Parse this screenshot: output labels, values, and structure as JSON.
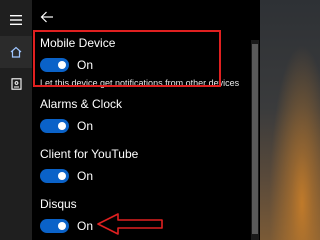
{
  "sidebar": {
    "menu_icon": "hamburger-icon",
    "home_icon": "home-icon",
    "notebook_icon": "notebook-icon"
  },
  "header": {
    "back_icon": "back-arrow-icon"
  },
  "settings": [
    {
      "name": "Mobile Device",
      "state": "On",
      "description": "Let this device get notifications from other devices"
    },
    {
      "name": "Alarms & Clock",
      "state": "On"
    },
    {
      "name": "Client for YouTube",
      "state": "On"
    },
    {
      "name": "Disqus",
      "state": "On"
    }
  ],
  "colors": {
    "accent": "#0a62c8",
    "annotation": "#e02020"
  }
}
